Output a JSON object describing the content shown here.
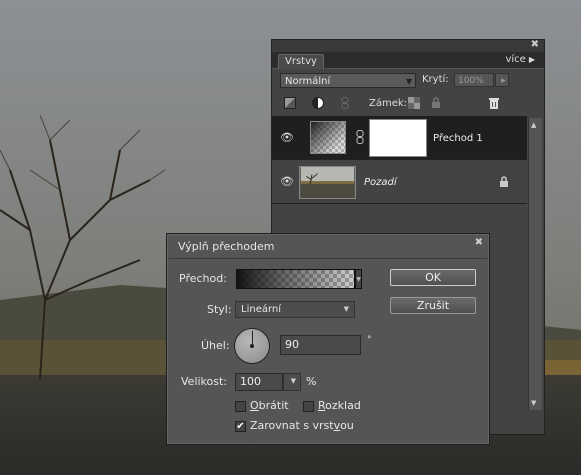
{
  "layers_panel": {
    "tab_label": "Vrstvy",
    "more_label": "více",
    "blend_mode": "Normální",
    "opacity_label": "Krytí:",
    "opacity_value": "100%",
    "lock_label": "Zámek:",
    "layers": [
      {
        "name": "Přechod 1",
        "selected": true
      },
      {
        "name": "Pozadí",
        "selected": false
      }
    ]
  },
  "dialog": {
    "title": "Výplň přechodem",
    "gradient_label": "Přechod:",
    "style_label": "Styl:",
    "style_value": "Lineární",
    "angle_label": "Úhel:",
    "angle_value": "90",
    "angle_unit": "°",
    "scale_label": "Velikost:",
    "scale_value": "100",
    "scale_unit": "%",
    "reverse_label": "Obrátit",
    "reverse_checked": false,
    "dither_label": "Rozklad",
    "dither_checked": false,
    "align_label": "Zarovnat s vrstvou",
    "align_checked": true,
    "ok_label": "OK",
    "cancel_label": "Zrušit"
  }
}
